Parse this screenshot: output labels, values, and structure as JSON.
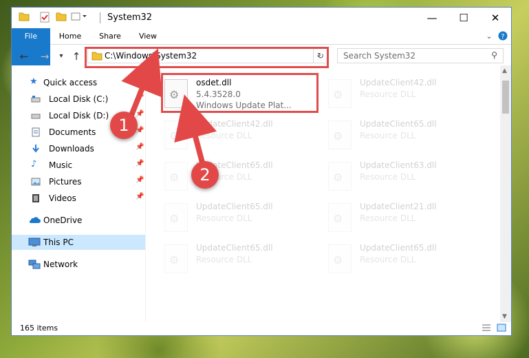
{
  "window": {
    "title": "System32"
  },
  "ribbon": {
    "tabs": [
      "File",
      "Home",
      "Share",
      "View"
    ]
  },
  "address": {
    "path": "C:\\Windows\\System32",
    "search_placeholder": "Search System32"
  },
  "sidebar": {
    "items": [
      {
        "label": "Quick access"
      },
      {
        "label": "Local Disk (C:)"
      },
      {
        "label": "Local Disk (D:)"
      },
      {
        "label": "Documents"
      },
      {
        "label": "Downloads"
      },
      {
        "label": "Music"
      },
      {
        "label": "Pictures"
      },
      {
        "label": "Videos"
      },
      {
        "label": "OneDrive"
      },
      {
        "label": "This PC"
      },
      {
        "label": "Network"
      }
    ]
  },
  "files": {
    "highlight": {
      "name": "osdet.dll",
      "version": "5.4.3528.0",
      "desc": "Windows Update Plat..."
    },
    "others": [
      {
        "name": "UpdateClient42.dll",
        "desc": "Resource DLL"
      },
      {
        "name": "UpdateClient42.dll",
        "desc": "Resource DLL"
      },
      {
        "name": "UpdateClient65.dll",
        "desc": "Resource DLL"
      },
      {
        "name": "UpdateClient65.dll",
        "desc": "Resource DLL"
      },
      {
        "name": "UpdateClient63.dll",
        "desc": "Resource DLL"
      },
      {
        "name": "UpdateClient65.dll",
        "desc": "Resource DLL"
      },
      {
        "name": "UpdateClient21.dll",
        "desc": "Resource DLL"
      },
      {
        "name": "UpdateClient65.dll",
        "desc": "Resource DLL"
      },
      {
        "name": "UpdateClient65.dll",
        "desc": "Resource DLL"
      }
    ]
  },
  "status": {
    "count": "165 items"
  },
  "annotations": {
    "step1": "1",
    "step2": "2"
  },
  "colors": {
    "accent": "#1979ca",
    "highlight": "#e14c4c",
    "selection": "#cce8ff"
  }
}
